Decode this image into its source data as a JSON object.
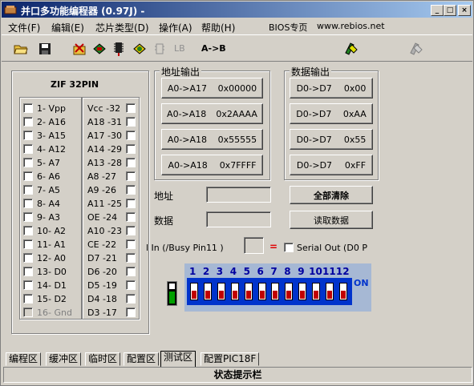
{
  "window": {
    "title": "并口多功能编程器 (0.97J) -",
    "min_label": "_",
    "max_label": "□",
    "close_label": "×"
  },
  "menu": {
    "items": [
      "文件(F)",
      "编辑(E)",
      "芯片类型(D)",
      "操作(A)",
      "帮助(H)"
    ],
    "bios": "BIOS专页",
    "website": "www.rebios.net"
  },
  "toolbar": {
    "lb_label": "LB",
    "ab_label": "A->B",
    "icons": [
      "open-folder-icon",
      "save-disk-icon",
      "erase-icon",
      "chip-icon",
      "chip-write-icon",
      "chip-verify-icon",
      "chip-disabled-icon",
      "lock-icon",
      "tool-icon"
    ]
  },
  "zif": {
    "title": "ZIF 32PIN",
    "left_pins": [
      "1- Vpp",
      "2- A16",
      "3- A15",
      "4- A12",
      "5- A7",
      "6- A6",
      "7- A5",
      "8- A4",
      "9- A3",
      "10- A2",
      "11- A1",
      "12- A0",
      "13- D0",
      "14- D1",
      "15- D2",
      "16- Gnd"
    ],
    "right_pins": [
      "Vcc -32",
      "A18 -31",
      "A17 -30",
      "A14 -29",
      "A13 -28",
      "A8 -27",
      "A9 -26",
      "A11 -25",
      "OE -24",
      "A10 -23",
      "CE -22",
      "D7 -21",
      "D6 -20",
      "D5 -19",
      "D4 -18",
      "D3 -17"
    ]
  },
  "addr_out": {
    "title": "地址输出",
    "buttons": [
      {
        "range": "A0->A17",
        "value": "0x00000"
      },
      {
        "range": "A0->A18",
        "value": "0x2AAAA"
      },
      {
        "range": "A0->A18",
        "value": "0x55555"
      },
      {
        "range": "A0->A18",
        "value": "0x7FFFF"
      }
    ]
  },
  "data_out": {
    "title": "数据输出",
    "buttons": [
      {
        "range": "D0->D7",
        "value": "0x00"
      },
      {
        "range": "D0->D7",
        "value": "0xAA"
      },
      {
        "range": "D0->D7",
        "value": "0x55"
      },
      {
        "range": "D0->D7",
        "value": "0xFF"
      }
    ]
  },
  "fields": {
    "address_label": "地址",
    "data_label": "数据",
    "clear_all": "全部清除",
    "read_data": "读取数据"
  },
  "serial": {
    "busy_label": "l In (/Busy Pin11 )",
    "equals": "=",
    "serial_out_label": "Serial Out (D0 P"
  },
  "dip": {
    "numbers": [
      "1",
      "2",
      "3",
      "4",
      "5",
      "6",
      "7",
      "8",
      "9",
      "10",
      "11",
      "12"
    ],
    "on_label": "ON"
  },
  "tabs": [
    "编程区",
    "缓冲区",
    "临时区",
    "配置区",
    "测试区",
    "配置PIC18F"
  ],
  "status": "状态提示栏"
}
